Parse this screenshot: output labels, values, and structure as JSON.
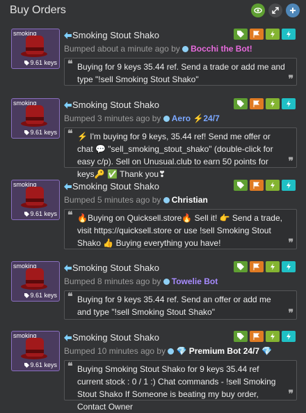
{
  "header": {
    "title": "Buy Orders"
  },
  "colors": {
    "background": "#333436",
    "item_border": "#8a6fbf",
    "btn_green": "#5f9f32",
    "btn_orange": "#e07b23",
    "btn_lime": "#84b431",
    "btn_cyan": "#1fc0c5"
  },
  "listings": [
    {
      "quality": "smoking",
      "price": "9.61 keys",
      "name": "Smoking Stout Shako",
      "bumped": "Bumped about a minute ago by",
      "user": "Bocchi the Bot!",
      "message": "Buying for 9 keys 35.44 ref. Send a trade or add me and type \"!sell Smoking Stout Shako\""
    },
    {
      "quality": "smoking",
      "price": "9.61 keys",
      "name": "Smoking Stout Shako",
      "bumped": "Bumped 3 minutes ago by",
      "user": "Aero ⚡24/7",
      "message": "⚡ I'm buying for 9 keys, 35.44 ref! Send me offer or chat 💬 \"sell_smoking_stout_shako\" (double-click for easy c/p). Sell on Unusual.club to earn 50 points for keys🔑 ✅ Thank you❣"
    },
    {
      "quality": "smoking",
      "price": "9.61 keys",
      "name": "Smoking Stout Shako",
      "bumped": "Bumped 5 minutes ago by",
      "user": "Christian",
      "message": "🔥Buying on Quicksell.store🔥 Sell it! 👉 Send a trade, visit https://quicksell.store or use !sell Smoking Stout Shako 👍 Buying everything you have!"
    },
    {
      "quality": "smoking",
      "price": "9.61 keys",
      "name": "Smoking Stout Shako",
      "bumped": "Bumped 8 minutes ago by",
      "user": "Towelie Bot",
      "message": "Buying for 9 keys 35.44 ref. Send an offer or add me and type \"!sell Smoking Stout Shako\""
    },
    {
      "quality": "smoking",
      "price": "9.61 keys",
      "name": "Smoking Stout Shako",
      "bumped": "Bumped 10 minutes ago by",
      "user": "💎 Premium Bot 24/7 💎",
      "message": "Buying Smoking Stout Shako for 9 keys 35.44 ref current stock : 0 / 1 :) Chat commands - !sell Smoking Stout Shako If Someone is beating my buy order, Contact Owner"
    }
  ]
}
